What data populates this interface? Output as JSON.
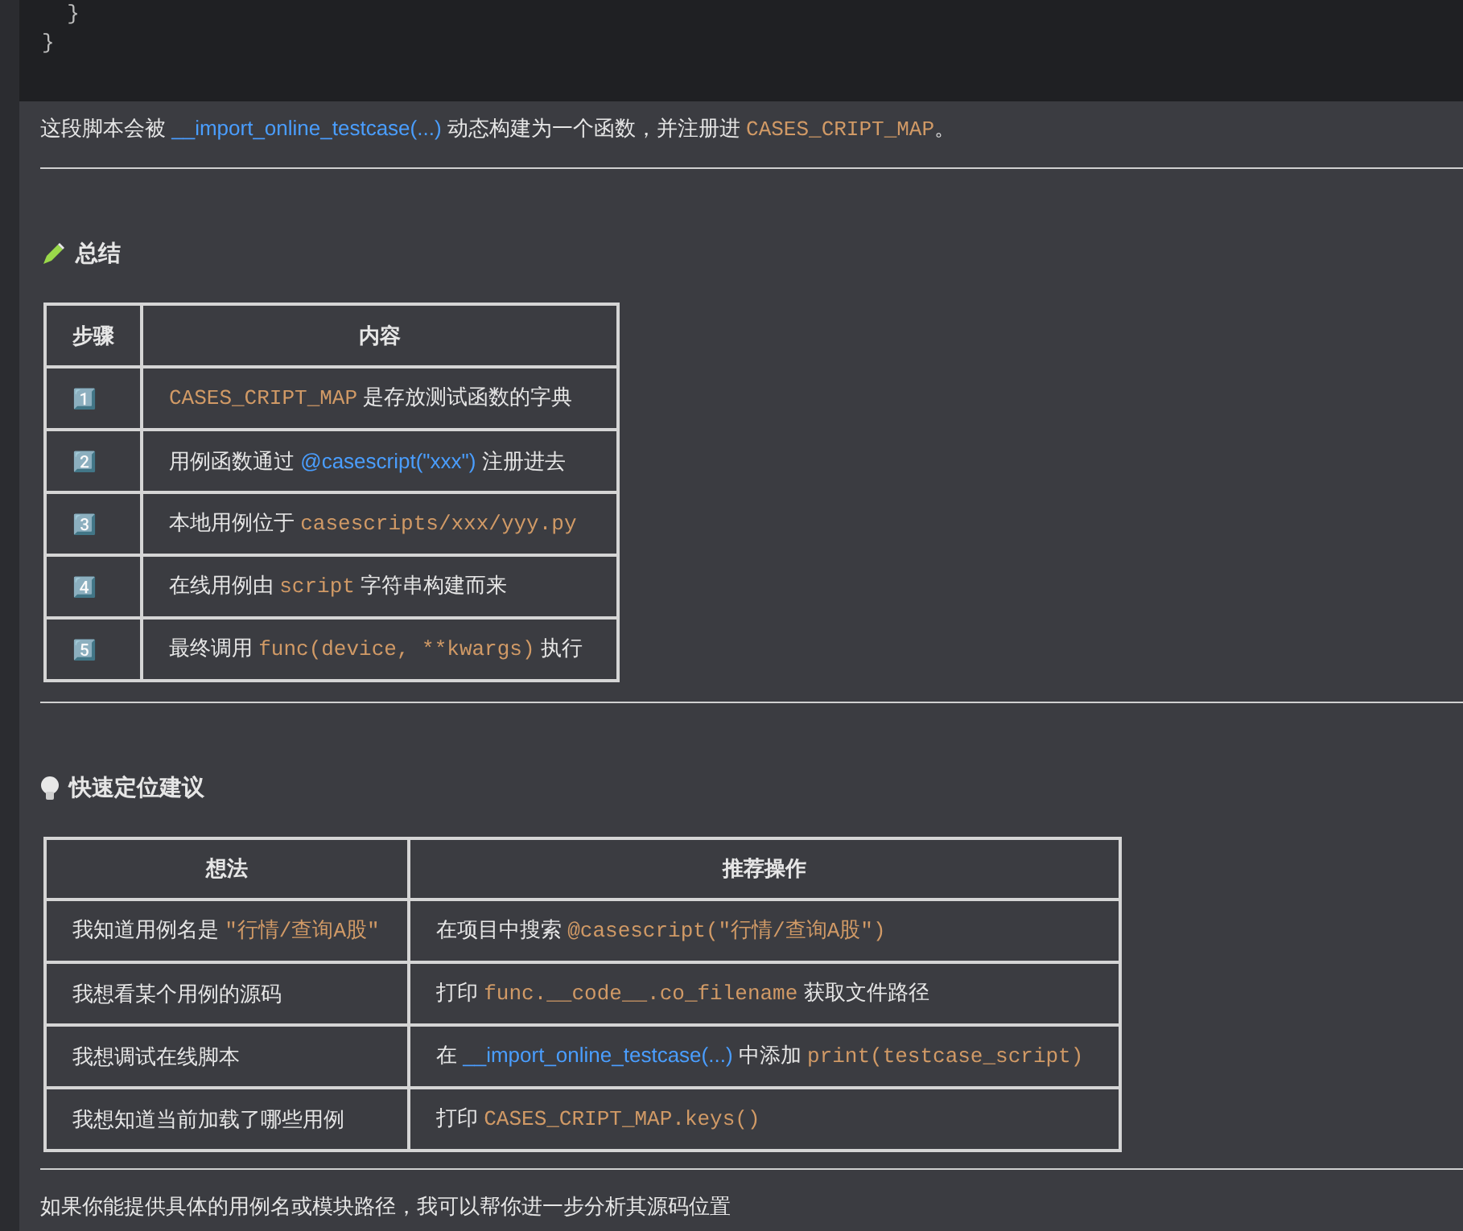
{
  "code_block": {
    "lines": [
      "  }",
      "}"
    ]
  },
  "intro": [
    {
      "kind": "text",
      "text": "这段脚本会被 "
    },
    {
      "kind": "link",
      "text": "__import_online_testcase(...)"
    },
    {
      "kind": "text",
      "text": " 动态构建为一个函数，并注册进 "
    },
    {
      "kind": "code",
      "text": "CASES_CRIPT_MAP"
    },
    {
      "kind": "text",
      "text": "。"
    }
  ],
  "summary": {
    "heading": "总结",
    "columns": [
      "步骤",
      "内容"
    ],
    "rows": [
      {
        "step": "1️⃣",
        "content": [
          {
            "kind": "code",
            "text": "CASES_CRIPT_MAP"
          },
          {
            "kind": "text",
            "text": " 是存放测试函数的字典"
          }
        ]
      },
      {
        "step": "2️⃣",
        "content": [
          {
            "kind": "text",
            "text": "用例函数通过 "
          },
          {
            "kind": "link",
            "text": "@casescript(\"xxx\")"
          },
          {
            "kind": "text",
            "text": " 注册进去"
          }
        ]
      },
      {
        "step": "3️⃣",
        "content": [
          {
            "kind": "text",
            "text": "本地用例位于 "
          },
          {
            "kind": "code",
            "text": "casescripts/xxx/yyy.py"
          }
        ]
      },
      {
        "step": "4️⃣",
        "content": [
          {
            "kind": "text",
            "text": "在线用例由 "
          },
          {
            "kind": "code",
            "text": "script"
          },
          {
            "kind": "text",
            "text": " 字符串构建而来"
          }
        ]
      },
      {
        "step": "5️⃣",
        "content": [
          {
            "kind": "text",
            "text": "最终调用 "
          },
          {
            "kind": "code",
            "text": "func(device, **kwargs)"
          },
          {
            "kind": "text",
            "text": " 执行"
          }
        ]
      }
    ]
  },
  "tips": {
    "heading": "快速定位建议",
    "columns": [
      "想法",
      "推荐操作"
    ],
    "rows": [
      {
        "idea": [
          {
            "kind": "text",
            "text": "我知道用例名是 "
          },
          {
            "kind": "code",
            "text": "\"行情/查询A股\""
          }
        ],
        "action": [
          {
            "kind": "text",
            "text": "在项目中搜索 "
          },
          {
            "kind": "code",
            "text": "@casescript(\"行情/查询A股\")"
          }
        ]
      },
      {
        "idea": [
          {
            "kind": "text",
            "text": "我想看某个用例的源码"
          }
        ],
        "action": [
          {
            "kind": "text",
            "text": "打印 "
          },
          {
            "kind": "code",
            "text": "func.__code__.co_filename"
          },
          {
            "kind": "text",
            "text": " 获取文件路径"
          }
        ]
      },
      {
        "idea": [
          {
            "kind": "text",
            "text": "我想调试在线脚本"
          }
        ],
        "action": [
          {
            "kind": "text",
            "text": "在 "
          },
          {
            "kind": "link",
            "text": "__import_online_testcase(...)"
          },
          {
            "kind": "text",
            "text": " 中添加 "
          },
          {
            "kind": "code",
            "text": "print(testcase_script)"
          }
        ]
      },
      {
        "idea": [
          {
            "kind": "text",
            "text": "我想知道当前加载了哪些用例"
          }
        ],
        "action": [
          {
            "kind": "text",
            "text": "打印 "
          },
          {
            "kind": "code",
            "text": "CASES_CRIPT_MAP.keys()"
          }
        ]
      }
    ]
  },
  "closing": "如果你能提供具体的用例名或模块路径，我可以帮你进一步分析其源码位置"
}
